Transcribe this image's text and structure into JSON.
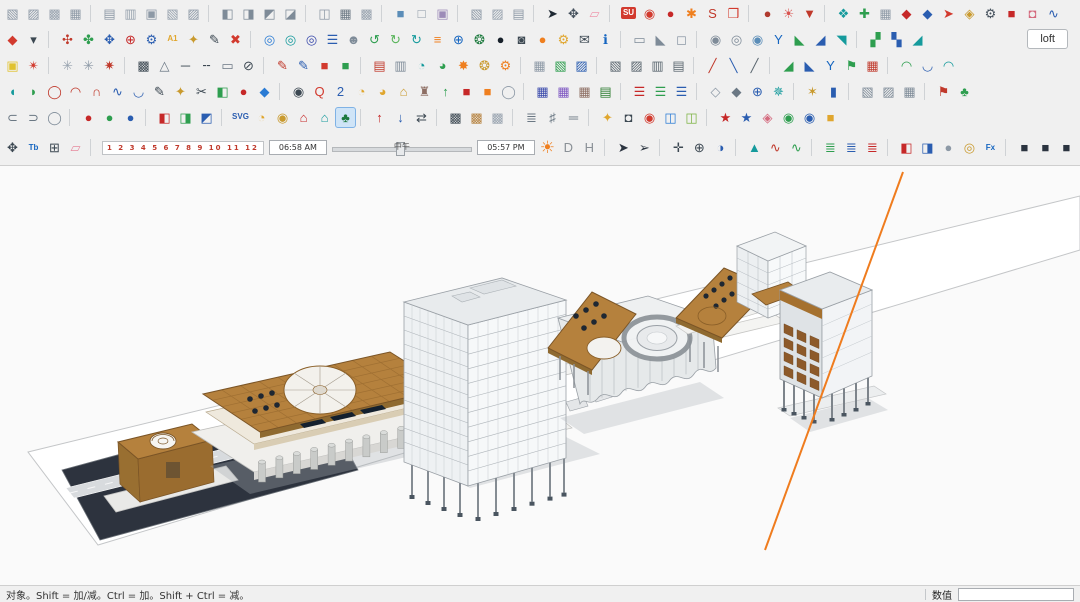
{
  "toolbars": {
    "loft_label": "loft",
    "row1": [
      "push-cube|▧|#8d99a6",
      "pull-cube|▨|#8d99a6",
      "shell-cube|▩|#97a2ae",
      "grid-cube|▦|#8d99a6",
      "sep",
      "face-cube|▤|#8d99a6",
      "edge-cube|▥|#97a2ae",
      "panel-cube|▣|#8d99a6",
      "wrap-cube|▧|#97a2ae",
      "slice-cube|▨|#8d99a6",
      "sep",
      "solid-union|◧|#7e8b98",
      "solid-subtract|◨|#7e8b98",
      "solid-trim|◩|#7e8b98",
      "solid-intersect|◪|#7e8b98",
      "sep",
      "mesh-box|◫|#8d99a6",
      "quad-grid|▦|#6b7884",
      "soft-mesh|▩|#97a2ae",
      "sep",
      "component-blue|■|#5b8db8",
      "group-outline|□|#8d99a6",
      "tag-purple|▣|#9c8bb8",
      "sep",
      "stamp-cube|▧|#8d99a6",
      "flip-cube|▨|#97a2ae",
      "lathe-cube|▤|#8d99a6",
      "sep",
      "select-arrow|➤|#1f2933",
      "pan-tool|✥|#44505c",
      "eraser|▱|#ef9aae",
      "sep",
      "su-logo|SU|#ffffff",
      "paint-bucket|◉|#d23a2e",
      "material-ball|●|#c62828",
      "flower-burst|✱|#ef7f1f",
      "style-dollar|S|#c0392b",
      "red-bin|❒|#d23a2e",
      "sep",
      "render-ball|●|#b03a2e",
      "sun-study|☀|#d9534f",
      "drop-red|▼|#c0392b",
      "sep",
      "lib-teal|❖|#159a9c",
      "lib-green|✚|#2e9e4f",
      "lib-gray|▦|#8d99a6",
      "gem-red|◆|#c62828",
      "gem-blue|◆|#2a5db0",
      "launch-red|➤|#d23a2e",
      "pin-gold|◈|#c99a2e",
      "gear-dark|⚙|#44505c",
      "chip-red|■|#c62828",
      "chip-rose|◘|#d46a7e",
      "wave-blue|∿|#2a5db0"
    ],
    "row2": [
      "export-kit|◆|#d23a2e",
      "caret-down|▾|#3c4852",
      "sep",
      "pinwheel-red|✣|#c0392b",
      "pinwheel-green|✤|#2e9e4f",
      "pinwheel-blue|✥|#2a5db0",
      "target-red|⊕|#c62828",
      "gear-blue|⚙|#2a5db0",
      "sheet-a1|A1|#e0a62e",
      "marker-gold|✦|#c99a2e",
      "pencil-tool|✎|#3c4852",
      "delete-x|✖|#d23a2e",
      "sep",
      "orbit-azure|◎|#2a7bd4",
      "orbit-teal|◎|#159a9c",
      "orbit-navy|◎|#3949ab",
      "stack-blue|☰|#2a5db0",
      "profile-user|☻|#7e8b98",
      "recycle-green|↺|#2e9e4f",
      "recycle-lime|↻|#58b45a",
      "refresh-teal|↻|#159a9c",
      "list-orange|≡|#ef7f1f",
      "add-circle|⊕|#1565c0",
      "tree-circle|❂|#1d7a3e",
      "night-circle|●|#17202a",
      "checker-ball|◙|#3c4852",
      "orange-ball|●|#ef7f1f",
      "gear-pair|⚙|#e0a62e",
      "mail-tool|✉|#3c4852",
      "info-circle|ℹ|#1565c0",
      "sep",
      "ruler-gray|▭|#7e8b98",
      "angle-gray|◣|#7e8b98",
      "cube-outline|◻|#8d99a6",
      "sep",
      "ring-solid|◉|#7e8b98",
      "ring-open|◎|#7e8b98",
      "globe-grid|◉|#5b8db8",
      "y-export|Y|#1565c0",
      "wedge-green|◣|#2e9e4f",
      "wedge-blue|◢|#2a5db0",
      "fan-teal|◥|#159a9c",
      "sep",
      "grad-green|▞|#2e9e4f",
      "grad-blue|▚|#2a5db0",
      "slope-teal|◢|#159a9c"
    ],
    "row3": [
      "palette-yellow|▣|#e0c22e",
      "spark-red|✴|#d23a2e",
      "sep",
      "web-light|✳|#97a2ae",
      "web-mid|✳|#8d99a6",
      "web-red|✷|#c0392b",
      "sep",
      "checker-dark|▩|#3c4852",
      "tri-outline|△|#6b7884",
      "line-tool|─|#3c4852",
      "dash-tool|╌|#3c4852",
      "rect-outline|▭|#6b7884",
      "circle-slash|⊘|#3c4852",
      "sep",
      "pencil-red|✎|#c0392b",
      "pencil-blue|✎|#2a5db0",
      "swatch-red|■|#d23a2e",
      "swatch-green|■|#2e9e4f",
      "sep",
      "doc-red|▤|#c0392b",
      "doc-gray|▥|#7e8b98",
      "fan-q1|◔|#159a9c",
      "fan-q3|◕|#2e9e4f",
      "sun-flat|✸|#ef7f1f",
      "medal-gold|❂|#c99a2e",
      "gear-orange|⚙|#ef7f1f",
      "sep",
      "cubes-gray|▦|#8d99a6",
      "cube-green|▧|#2e9e4f",
      "cube-blue|▨|#2a5db0",
      "sep",
      "hatch-a|▧|#5b6770",
      "hatch-b|▨|#5b6770",
      "hatch-c|▥|#5b6770",
      "hatch-d|▤|#5b6770",
      "sep",
      "diag-red|╱|#c0392b",
      "diag-blue|╲|#2a5db0",
      "diag-gray|╱|#5b6770",
      "sep",
      "slope-green|◢|#2e9e4f",
      "slope-blue|◣|#2a5db0",
      "y-blue|Y|#1565c0",
      "flag-green|⚑|#2e9e4f",
      "grid-red|▦|#c0392b",
      "sep",
      "arch-green|◠|#2e9e4f",
      "arch-blue|◡|#2a5db0",
      "arch-teal|◠|#159a9c"
    ],
    "row4": [
      "seg-teal|◖|#159a9c",
      "seg-green|◗|#2e9e4f",
      "ring-red|◯|#c0392b",
      "arc-red|◠|#c0392b",
      "bump-red|∩|#c0392b",
      "wave-navy|∿|#2a5db0",
      "dip-blue|◡|#2a5db0",
      "curve-pencil|✎|#3c4852",
      "key-gold|✦|#c99a2e",
      "scissors|✂|#3c4852",
      "cube-mint|◧|#2e9e4f",
      "ball-red|●|#c62828",
      "gem-azure|◆|#2a7bd4",
      "sep",
      "eye-tool|◉|#3c4852",
      "q-badge|Q|#d23a2e",
      "two-badge|2|#2a5db0",
      "clock-gold|◔|#e0a62e",
      "bell-amber|◕|#e0a62e",
      "house-gold|⌂|#c99a2e",
      "turret-brown|♜|#8d6e63",
      "up-green|↑|#2e9e4f",
      "box-red|■|#c62828",
      "box-orange|■|#ef7f1f",
      "cyl-gray|◯|#8d99a6",
      "sep",
      "crate-navy|▦|#3949ab",
      "crate-violet|▦|#7e57c2",
      "crate-brown|▦|#8d6e63",
      "cash-green|▤|#2e7d32",
      "sep",
      "layers-red|☰|#c62828",
      "layers-green|☰|#2e9e4f",
      "layers-blue|☰|#2a5db0",
      "sep",
      "iso-light|◇|#8d99a6",
      "iso-dark|◆|#6b7884",
      "target-azure|⊕|#2a5db0",
      "spray-teal|✵|#159a9c",
      "sep",
      "star-gold|✶|#c99a2e",
      "bar-chart|▮|#2a5db0",
      "sep",
      "cube-steel-a|▧|#7e8b98",
      "cube-steel-b|▨|#7e8b98",
      "cube-steel-c|▦|#7e8b98",
      "sep",
      "flag-red|⚑|#c0392b",
      "club-green|♣|#2e9e4f"
    ],
    "row5": [
      "hook-left|⊂|#6b7884",
      "hook-right|⊃|#6b7884",
      "ring-thin|◯|#7e8b98",
      "sep",
      "ball-cherry|●|#c62828",
      "ball-leaf|●|#2e9e4f",
      "ball-sky|●|#2a5db0",
      "sep",
      "cube-red|◧|#c62828",
      "cube-green2|◨|#2e9e4f",
      "cube-blue2|◩|#2a5db0",
      "sep",
      "svg-export|SVG|#2a5db0",
      "alarm-amber|◔|#e0a62e",
      "coin-gold|◉|#c99a2e",
      "house-red|⌂|#c62828",
      "house-teal|⌂|#159a9c",
      "tree-park|♣|#1d7a3e|a",
      "sep",
      "up-red|↑|#c62828",
      "down-blue|↓|#2a5db0",
      "swap-lr|⇄|#3c4852",
      "sep",
      "panel-dark|▩|#3c4852",
      "panel-tan|▩|#b5813d",
      "panel-light|▩|#97a2ae",
      "sep",
      "stair-tool|≣|#6b7884",
      "fence-tool|♯|#6b7884",
      "pipe-tool|═|#6b7884",
      "sep",
      "bolt-gold|✦|#e0a62e",
      "cam-dark|◘|#3c4852",
      "loc-red|◉|#d23a2e",
      "cube-sky2|◫|#2a7bd4",
      "cube-lime|◫|#7cb342",
      "sep",
      "star-crimson|★|#c62828",
      "star-azure|★|#2a5db0",
      "pin-rose|◈|#d46a7e",
      "disc-green|◉|#2e9e4f",
      "disc-blue|◉|#2a5db0",
      "box-amber|■|#e0a62e"
    ],
    "row6_left": [
      "nav-cross|✥|#3c4852",
      "tb-badge|Tb|#1565c0",
      "table-grid|⊞|#3c4852",
      "eraser-soft|▱|#e78ca0",
      "sep"
    ],
    "row6_right": [
      "sun-shadows|☀|#ef7f1f",
      "letter-d|D|#8a9096",
      "letter-h|H|#8a9096",
      "sep",
      "cursor-a|➤|#2b3440",
      "cursor-b|➢|#2b3440",
      "sep",
      "compass-tool|✛|#3c4852",
      "dim-tool|⊕|#3c4852",
      "protractor-blue|◑|#2a5db0",
      "sep",
      "mirror-teal|▲|#159a9c",
      "wave-red|∿|#c0392b",
      "wave-green|∿|#2e9e4f",
      "sep",
      "stack-green|≣|#2e9e4f",
      "stack-azure|≣|#2a5db0",
      "stack-red|≣|#c62828",
      "sep",
      "box3d-red|◧|#c62828",
      "box3d-blue|◨|#2a5db0",
      "blob-gray|●|#8d99a6",
      "ring-gold|◎|#c99a2e",
      "fx-badge|Fx|#1565c0",
      "sep",
      "preset-dark-1|■|#2b3440",
      "preset-dark-2|■|#2b3440",
      "preset-dark-3|■|#2b3440",
      "preset-dark-4|■|#2b3440",
      "sep",
      "iso-arrow-red|◥|#c62828",
      "iso-arrow-green|◥|#2e9e4f",
      "iso-arrow-blue|◥|#2a5db0",
      "iso-arrow-gold|◥|#c99a2e",
      "pin-red|◉|#d23a2e",
      "pin-blue|◉|#2a5db0"
    ]
  },
  "shadow_bar": {
    "hours": "1 2 3 4 5 6 7 8 9 10 11 12",
    "time_start": "06:58 AM",
    "time_noon": "中午",
    "time_end": "05:57 PM"
  },
  "viewport": {
    "colors": {
      "roof": "#b5813d",
      "roof-dark": "#7a5426",
      "roof-side": "#996f31",
      "roof-front": "#9a6c2f",
      "ground-dark": "#2d333e",
      "band-stroke": "#c4c6c8",
      "accent-orange": "#ef7c1e",
      "window-brown": "#8d5a2a",
      "shadow": "#a7adb3",
      "wire": "#9aa0a6"
    }
  },
  "statusbar": {
    "hint": "对象。Shift = 加/减。Ctrl = 加。Shift + Ctrl = 减。",
    "value_label": "数值",
    "value_text": ""
  }
}
